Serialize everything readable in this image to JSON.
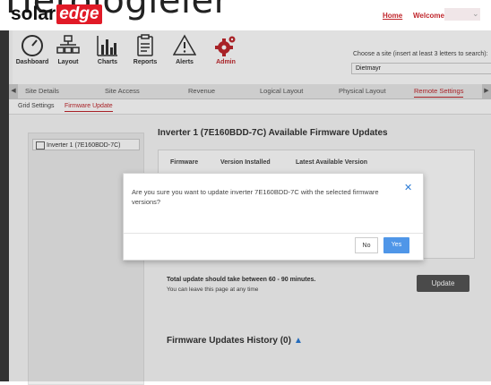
{
  "caption": "Herologieier",
  "brand": {
    "prefix": "solar",
    "suffix": "edge"
  },
  "header": {
    "home": "Home",
    "welcome": "Welcome"
  },
  "nav": [
    {
      "label": "Dashboard",
      "icon": "gauge-icon"
    },
    {
      "label": "Layout",
      "icon": "layout-icon"
    },
    {
      "label": "Charts",
      "icon": "bar-chart-icon"
    },
    {
      "label": "Reports",
      "icon": "report-icon"
    },
    {
      "label": "Alerts",
      "icon": "alert-icon"
    },
    {
      "label": "Admin",
      "icon": "gear-icon"
    }
  ],
  "site": {
    "label": "Choose a site (insert at least 3 letters to search):",
    "value": "Dietmayr"
  },
  "main_tabs": [
    "Site Details",
    "Site Access",
    "Revenue",
    "Logical Layout",
    "Physical Layout",
    "Remote Settings"
  ],
  "sub_tabs": [
    "Grid Settings",
    "Firmware Update"
  ],
  "inverter": {
    "item": "Inverter 1 (7E160BDD-7C)"
  },
  "panel": {
    "title": "Inverter 1 (7E160BDD-7C) Available Firmware Updates",
    "columns": [
      "Firmware",
      "Version Installed",
      "Latest Available Version"
    ]
  },
  "update": {
    "note": "Total update should take between 60 - 90 minutes.",
    "note2": "You can leave this page at any time",
    "button": "Update"
  },
  "history": {
    "title": "Firmware Updates History (0)"
  },
  "modal": {
    "text": "Are you sure you want to update inverter 7E160BDD-7C with the selected firmware versions?",
    "no": "No",
    "yes": "Yes"
  },
  "colors": {
    "accent": "#c0272d",
    "primary_button": "#4f96e8"
  }
}
